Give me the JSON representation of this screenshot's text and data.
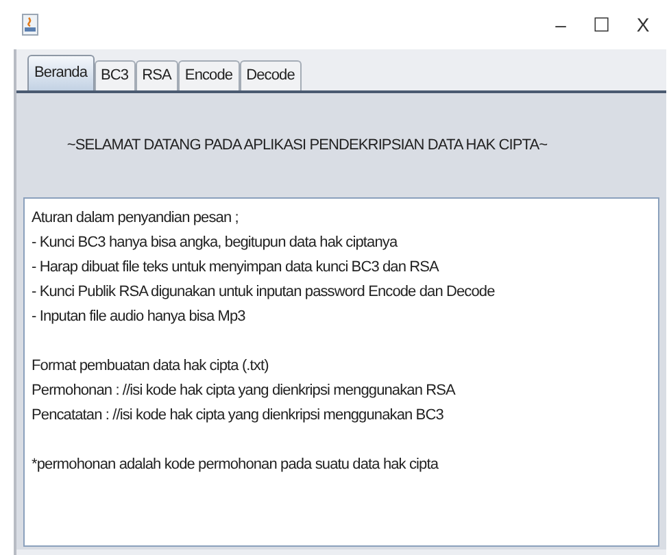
{
  "window": {
    "controls": [
      "–",
      "☐",
      "X"
    ]
  },
  "tabs": [
    {
      "label": "Beranda",
      "selected": true
    },
    {
      "label": "BC3",
      "selected": false
    },
    {
      "label": "RSA",
      "selected": false
    },
    {
      "label": "Encode",
      "selected": false
    },
    {
      "label": "Decode",
      "selected": false
    }
  ],
  "heading": "~SELAMAT DATANG PADA APLIKASI PENDEKRIPSIAN DATA HAK CIPTA~",
  "text_area": {
    "paragraphs": [
      [
        "Aturan dalam penyandian pesan ;",
        "- Kunci BC3 hanya bisa angka, begitupun data hak ciptanya",
        "- Harap dibuat file teks untuk menyimpan data kunci BC3 dan RSA",
        "- Kunci Publik RSA digunakan untuk inputan password Encode dan Decode",
        "- Inputan file audio hanya bisa Mp3"
      ],
      [
        "Format pembuatan data hak cipta (.txt)",
        "Permohonan : //isi kode hak cipta yang dienkripsi menggunakan RSA",
        "Pencatatan : //isi kode hak cipta yang dienkripsi menggunakan BC3"
      ],
      [
        "*permohonan adalah kode permohonan pada suatu data hak cipta"
      ]
    ]
  }
}
